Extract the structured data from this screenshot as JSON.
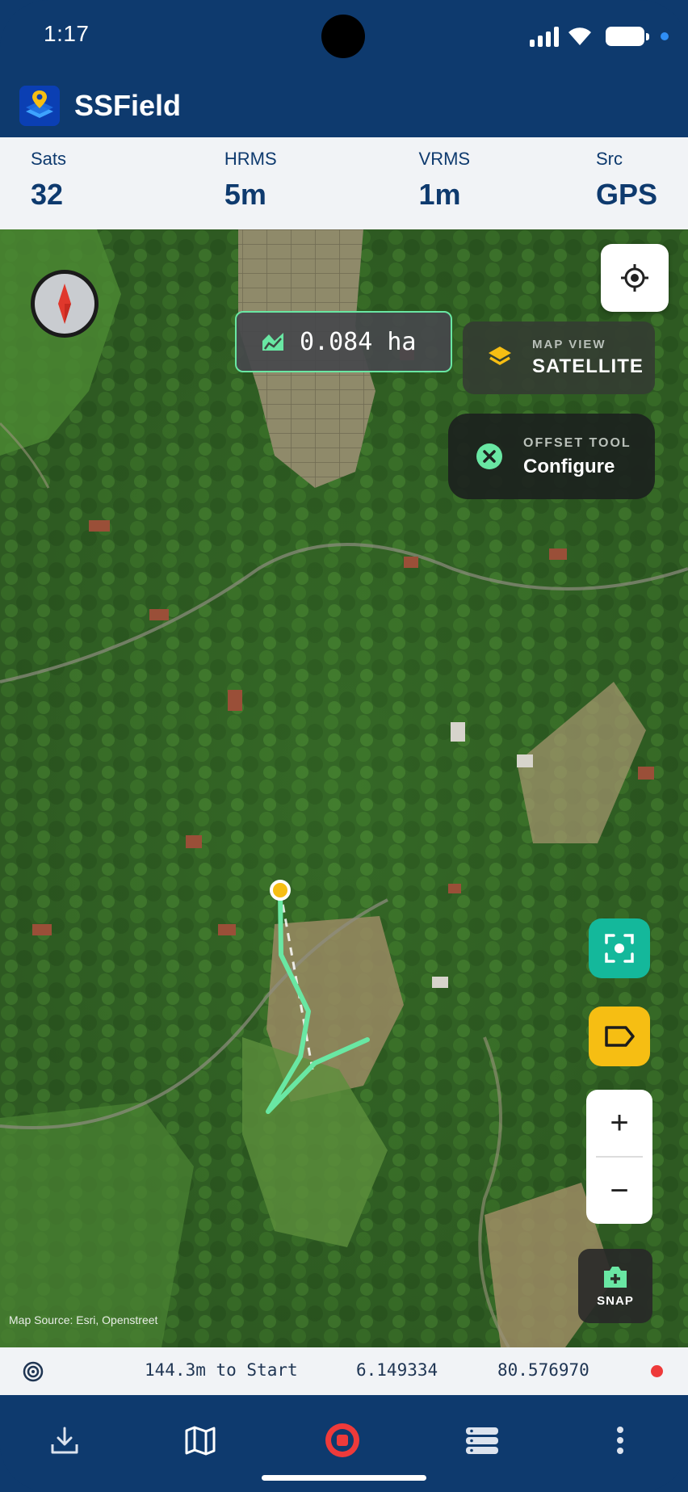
{
  "status_bar": {
    "time": "1:17",
    "icons": [
      "signal-icon",
      "wifi-icon",
      "battery-icon"
    ]
  },
  "app": {
    "title": "SSField",
    "logo": "app-logo-icon"
  },
  "stats": [
    {
      "label": "Sats",
      "value": "32"
    },
    {
      "label": "HRMS",
      "value": "5m"
    },
    {
      "label": "VRMS",
      "value": "1m"
    },
    {
      "label": "Src",
      "value": "GPS"
    }
  ],
  "map": {
    "area": {
      "value": "0.084 ha",
      "icon": "area-icon"
    },
    "map_view": {
      "caption": "MAP VIEW",
      "value": "SATELLITE",
      "icon": "layers-icon"
    },
    "offset_tool": {
      "caption": "OFFSET TOOL",
      "value": "Configure",
      "icon": "close-circle-icon"
    },
    "snap_label": "SNAP",
    "zoom_in": "+",
    "zoom_out": "−",
    "attribution": "Map Source: Esri, Openstreet"
  },
  "info_bar": {
    "distance": "144.3m to Start",
    "latitude": "6.149334",
    "longitude": "80.576970"
  },
  "nav": [
    "download-icon",
    "map-icon",
    "stop-record-icon",
    "layers-list-icon",
    "more-vert-icon"
  ],
  "colors": {
    "primary": "#0e3a6e",
    "track": "#69e7a3",
    "accent_teal": "#14b89b",
    "accent_yellow": "#f6be13",
    "record_red": "#ee3a3a"
  }
}
